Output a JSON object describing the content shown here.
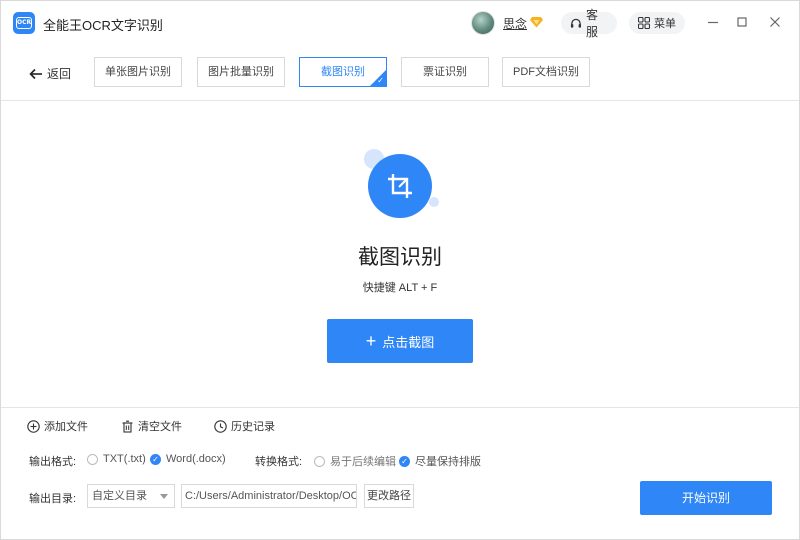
{
  "app": {
    "title": "全能王OCR文字识别",
    "logo_text": "OCR"
  },
  "header": {
    "username": "思念",
    "service_label": "客服",
    "menu_label": "菜单",
    "window_controls": [
      "minimize",
      "maximize",
      "close"
    ]
  },
  "toolbar": {
    "back_label": "返回",
    "tabs": [
      {
        "label": "单张图片识别",
        "active": false
      },
      {
        "label": "图片批量识别",
        "active": false
      },
      {
        "label": "截图识别",
        "active": true
      },
      {
        "label": "票证识别",
        "active": false
      },
      {
        "label": "PDF文档识别",
        "active": false
      }
    ]
  },
  "main": {
    "icon": "crop-icon",
    "title": "截图识别",
    "hotkey": "快捷键 ALT + F",
    "capture_button": "点击截图"
  },
  "bottom": {
    "actions": {
      "add_file": "添加文件",
      "clear_files": "清空文件",
      "history": "历史记录"
    },
    "output_format": {
      "label": "输出格式:",
      "options": [
        {
          "label": "TXT(.txt)",
          "checked": false
        },
        {
          "label": "Word(.docx)",
          "checked": true
        }
      ]
    },
    "convert_format": {
      "label": "转换格式:",
      "options": [
        {
          "label": "易于后续编辑",
          "checked": false
        },
        {
          "label": "尽量保持排版",
          "checked": true
        }
      ]
    },
    "output_dir": {
      "label": "输出目录:",
      "select_value": "自定义目录",
      "path_value": "C:/Users/Administrator/Desktop/OC",
      "change_button": "更改路径"
    },
    "start_button": "开始识别"
  },
  "colors": {
    "accent": "#2f86f6",
    "accent_light": "#d6e5fb",
    "border": "#d9d9d9"
  }
}
